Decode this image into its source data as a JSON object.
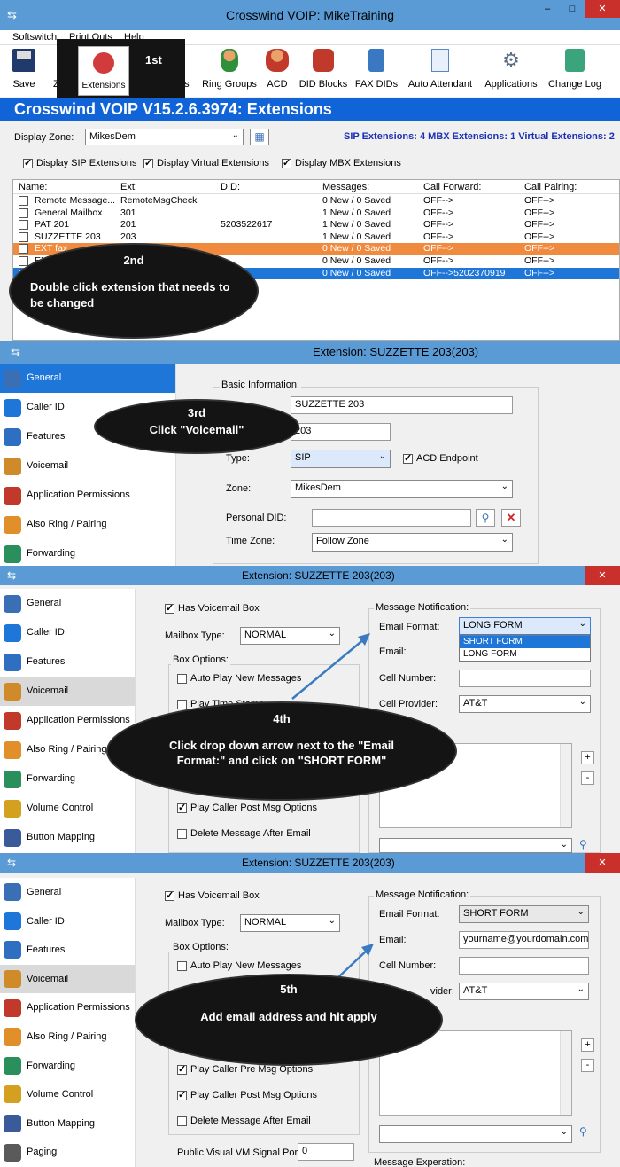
{
  "p1": {
    "title": "Crosswind VOIP: MikeTraining",
    "menu": [
      "Softswitch",
      "Print Outs",
      "Help"
    ],
    "toolbar": {
      "save": "Save",
      "z": "Z",
      "extensions": "Extensions",
      "ns": "ns",
      "ring_groups": "Ring Groups",
      "acd": "ACD",
      "did_blocks": "DID Blocks",
      "fax_dids": "FAX DIDs",
      "auto_attendant": "Auto Attendant",
      "applications": "Applications",
      "change_log": "Change Log"
    },
    "banner": "Crosswind VOIP V15.2.6.3974: Extensions",
    "display_zone_label": "Display Zone:",
    "display_zone_value": "MikesDem",
    "summary": "SIP Extensions: 4 MBX Extensions: 1 Virtual Extensions: 2",
    "filters": [
      "Display SIP Extensions",
      "Display Virtual Extensions",
      "Display MBX Extensions"
    ],
    "columns": [
      "Name:",
      "Ext:",
      "DID:",
      "Messages:",
      "Call Forward:",
      "Call Pairing:"
    ],
    "rows": [
      {
        "name": "Remote Message...",
        "ext": "RemoteMsgCheck",
        "did": "",
        "msgs": "0 New / 0 Saved",
        "fwd": "OFF-->",
        "pair": "OFF-->"
      },
      {
        "name": "General Mailbox",
        "ext": "301",
        "did": "",
        "msgs": "1 New / 0 Saved",
        "fwd": "OFF-->",
        "pair": "OFF-->"
      },
      {
        "name": "PAT 201",
        "ext": "201",
        "did": "5203522617",
        "msgs": "1 New / 0 Saved",
        "fwd": "OFF-->",
        "pair": "OFF-->"
      },
      {
        "name": "SUZZETTE 203",
        "ext": "203",
        "did": "",
        "msgs": "1 New / 0 Saved",
        "fwd": "OFF-->",
        "pair": "OFF-->"
      },
      {
        "name": "EXT fax",
        "ext": "",
        "did": "",
        "msgs": "0 New / 0 Saved",
        "fwd": "OFF-->",
        "pair": "OFF-->"
      },
      {
        "name": "EXT",
        "ext": "",
        "did": "",
        "msgs": "0 New / 0 Saved",
        "fwd": "OFF-->",
        "pair": "OFF-->"
      },
      {
        "name": "",
        "ext": "",
        "did": "",
        "msgs": "0 New / 0 Saved",
        "fwd": "OFF-->5202370919",
        "pair": "OFF-->"
      }
    ],
    "step1": "1st",
    "step2_n": "2nd",
    "step2_t": "Double click extension that needs to be changed"
  },
  "p2": {
    "title": "Extension: SUZZETTE 203(203)",
    "nav": [
      "General",
      "Caller ID",
      "Features",
      "Voicemail",
      "Application Permissions",
      "Also Ring / Pairing",
      "Forwarding"
    ],
    "group": "Basic Information:",
    "name_value": "SUZZETTE 203",
    "ext_value": "203",
    "type_label": "Type:",
    "type_value": "SIP",
    "acd": "ACD Endpoint",
    "zone_label": "Zone:",
    "zone_value": "MikesDem",
    "pdid_label": "Personal DID:",
    "tz_label": "Time Zone:",
    "tz_value": "Follow Zone",
    "step_n": "3rd",
    "step_t": "Click  \"Voicemail\""
  },
  "p3": {
    "title": "Extension: SUZZETTE 203(203)",
    "nav": [
      "General",
      "Caller ID",
      "Features",
      "Voicemail",
      "Application Permissions",
      "Also Ring / Pairing",
      "Forwarding",
      "Volume Control",
      "Button Mapping"
    ],
    "has_vm": "Has Voicemail Box",
    "mailbox_type_label": "Mailbox Type:",
    "mailbox_type_value": "NORMAL",
    "box_options": "Box Options:",
    "auto_play": "Auto Play New Messages",
    "play_time": "Play Time Stamp",
    "play_post": "Play Caller Post Msg Options",
    "delete_after": "Delete Message After Email",
    "msg_notif": "Message Notification:",
    "email_format_label": "Email Format:",
    "email_format_value": "LONG FORM",
    "dropdown_options": [
      "SHORT FORM",
      "LONG FORM"
    ],
    "email_label": "Email:",
    "cell_label": "Cell Number:",
    "provider_label": "Cell Provider:",
    "provider_value": "AT&T",
    "step_n": "4th",
    "step_t": "Click  drop down arrow next to the  \"Email Format:\" and click on   \"SHORT FORM\""
  },
  "p4": {
    "title": "Extension: SUZZETTE 203(203)",
    "nav": [
      "General",
      "Caller ID",
      "Features",
      "Voicemail",
      "Application Permissions",
      "Also Ring / Pairing",
      "Forwarding",
      "Volume Control",
      "Button Mapping",
      "Paging"
    ],
    "has_vm": "Has Voicemail Box",
    "mailbox_type_label": "Mailbox Type:",
    "mailbox_type_value": "NORMAL",
    "box_options": "Box Options:",
    "auto_play": "Auto Play New Messages",
    "play_pre": "Play Caller Pre Msg Options",
    "play_post": "Play Caller Post Msg Options",
    "delete_after": "Delete Message After Email",
    "public_port_label": "Public Visual VM Signal Port:",
    "public_port_value": "0",
    "msg_notif": "Message Notification:",
    "email_format_label": "Email Format:",
    "email_format_value": "SHORT FORM",
    "email_label": "Email:",
    "email_value": "yourname@yourdomain.com",
    "cell_label": "Cell Number:",
    "provider_label": "vider:",
    "provider_value": "AT&T",
    "msg_exp": "Message Experation:",
    "step_n": "5th",
    "step_t": "Add email address and hit apply"
  }
}
